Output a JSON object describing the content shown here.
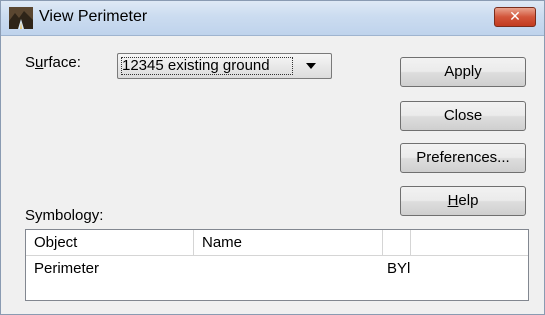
{
  "window": {
    "title": "View Perimeter",
    "close_glyph": "✕"
  },
  "surface": {
    "label_pre": "S",
    "label_u": "u",
    "label_post": "rface:",
    "selected": "12345 existing ground"
  },
  "buttons": {
    "apply": "Apply",
    "close": "Close",
    "preferences": "Preferences...",
    "help_u": "H",
    "help_rest": "elp"
  },
  "symbology": {
    "label": "Symbology:",
    "columns": [
      "Object",
      "Name",
      ""
    ],
    "rows": [
      {
        "object": "Perimeter",
        "name": "",
        "value": "BYl"
      }
    ]
  }
}
